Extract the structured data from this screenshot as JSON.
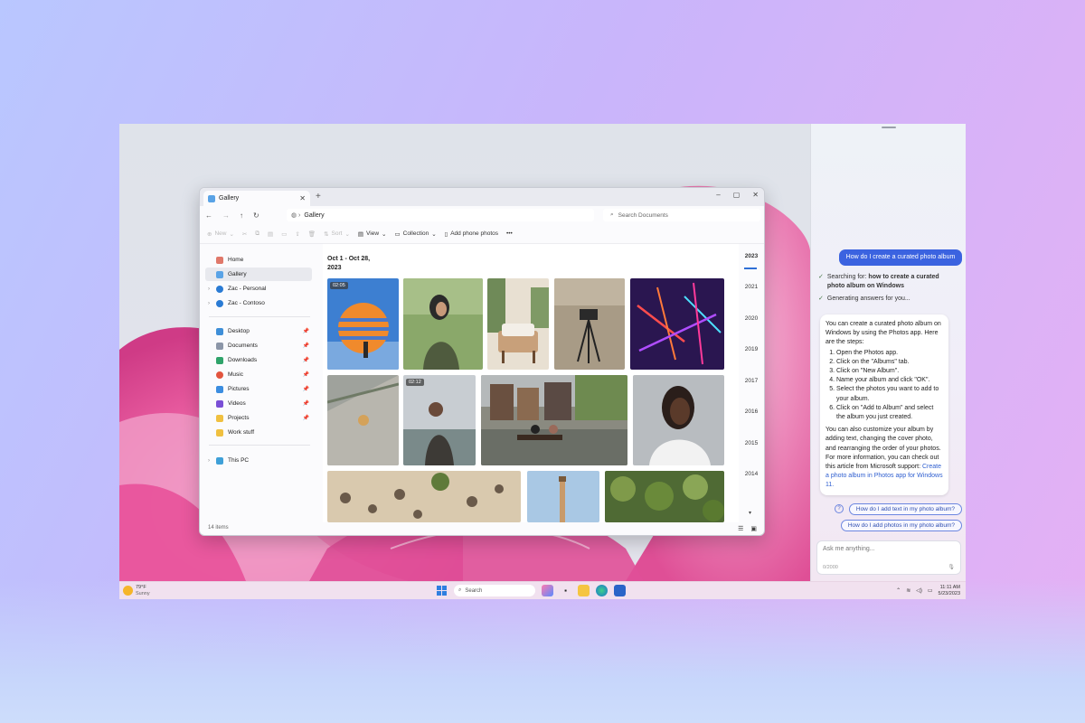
{
  "explorer": {
    "tab_title": "Gallery",
    "address": "Gallery",
    "search_placeholder": "Search Documents",
    "cmd": {
      "new": "New",
      "sort": "Sort",
      "view": "View",
      "collection": "Collection",
      "add_phone": "Add phone photos",
      "more": "•••"
    },
    "sidebar": {
      "home": "Home",
      "gallery": "Gallery",
      "zac_personal": "Zac - Personal",
      "zac_contoso": "Zac - Contoso",
      "desktop": "Desktop",
      "documents": "Documents",
      "downloads": "Downloads",
      "music": "Music",
      "pictures": "Pictures",
      "videos": "Videos",
      "projects": "Projects",
      "work_stuff": "Work stuff",
      "this_pc": "This PC"
    },
    "date_range": "Oct 1 - Oct 28, 2023",
    "video_badge_1": "02:05",
    "video_badge_2": "02:12",
    "years": [
      "2023",
      "2021",
      "2020",
      "2019",
      "2017",
      "2016",
      "2015",
      "2014"
    ],
    "status": "14 items"
  },
  "copilot": {
    "user_question": "How do I create a curated photo album",
    "searching_label": "Searching for:",
    "searching_query": "how to create a curated photo album on Windows",
    "generating": "Generating answers for you...",
    "answer_intro": "You can create a curated photo album on Windows by using the Photos app. Here are the steps:",
    "steps": [
      "Open the Photos app.",
      "Click on the \"Albums\" tab.",
      "Click on \"New Album\".",
      "Name your album and click \"OK\".",
      "Select the photos you want to add to your album.",
      "Click on \"Add to Album\" and select the album you just created."
    ],
    "answer_outro": "You can also customize your album by adding text, changing the cover photo, and rearranging the order of your photos.",
    "more_info": "For more information, you can check out this article from Microsoft support:",
    "link_text": "Create a photo album in Photos app for Windows 11.",
    "suggestion_1": "How do I add text in my photo album?",
    "suggestion_2": "How do I add photos in my photo album?",
    "input_placeholder": "Ask me anything...",
    "char_count": "0/2000"
  },
  "taskbar": {
    "temp": "79°F",
    "condition": "Sunny",
    "search": "Search",
    "time": "11:11 AM",
    "date": "5/23/2023"
  }
}
